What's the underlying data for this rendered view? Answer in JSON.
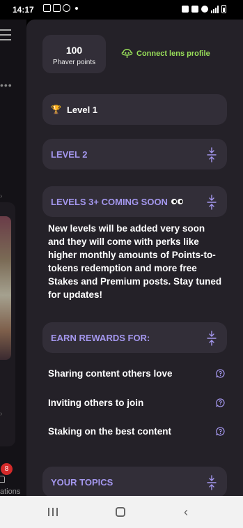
{
  "status_bar": {
    "time": "14:17"
  },
  "points": {
    "value": "100",
    "label": "Phaver points"
  },
  "lens": {
    "label": "Connect lens profile"
  },
  "sections": {
    "level1": {
      "title": "Level 1"
    },
    "level2": {
      "title": "LEVEL 2"
    },
    "levels3": {
      "title": "LEVELS 3+ COMING SOON",
      "text": "New levels will be added very soon and they will come with perks like higher monthly amounts of Points-to-tokens redemption and more free Stakes and Premium posts. Stay tuned for updates!"
    },
    "earn": {
      "title": "EARN REWARDS FOR:",
      "items": [
        {
          "label": "Sharing content others love"
        },
        {
          "label": "Inviting others to join"
        },
        {
          "label": "Staking on the best content"
        }
      ]
    },
    "topics": {
      "title": "YOUR TOPICS"
    }
  },
  "underlay": {
    "badge": "8",
    "nav_label": "ations"
  },
  "colors": {
    "accent": "#a497ee",
    "lens_green": "#9ae15a",
    "panel": "#242128",
    "card": "#322e38"
  }
}
